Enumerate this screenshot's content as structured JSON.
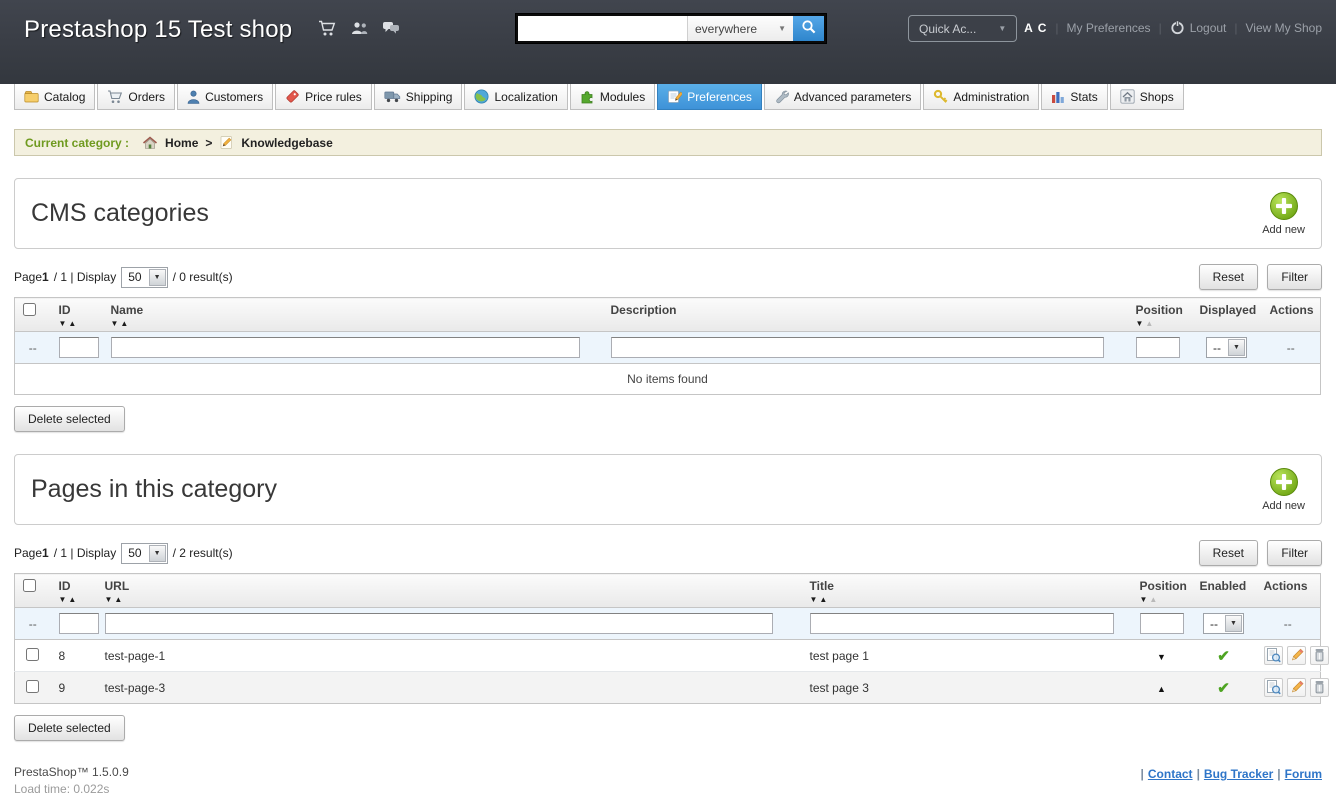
{
  "icons": {
    "sort_down": "▼",
    "sort_up": "▲",
    "dropdown_arrow": "▼",
    "check": "✔",
    "dash": "--",
    "pipe": "|",
    "breadcrumb_sep": ">"
  },
  "colors": {
    "header_bg": "#383C44",
    "active_tab_blue": "#4AA1DC",
    "breadcrumb_bg": "#F3F0DF",
    "breadcrumb_label_green": "#6F9A1F",
    "add_new_green": "#72AA16",
    "enabled_check_green": "#4EA422",
    "footer_link_blue": "#2E75C8",
    "filter_row_bg": "#EDF5FC"
  },
  "header": {
    "shop_title": "Prestashop 15 Test shop",
    "search_scope": "everywhere",
    "quick_access": "Quick Ac...",
    "user_initials": "A C",
    "my_preferences": "My Preferences",
    "logout": "Logout",
    "view_my_shop": "View My Shop"
  },
  "nav": {
    "tabs": [
      {
        "label": "Catalog",
        "icon": "folder-icon"
      },
      {
        "label": "Orders",
        "icon": "cart-icon"
      },
      {
        "label": "Customers",
        "icon": "customer-icon"
      },
      {
        "label": "Price rules",
        "icon": "price-tag-icon"
      },
      {
        "label": "Shipping",
        "icon": "truck-icon"
      },
      {
        "label": "Localization",
        "icon": "globe-icon"
      },
      {
        "label": "Modules",
        "icon": "puzzle-icon"
      },
      {
        "label": "Preferences",
        "icon": "notepad-pencil-icon",
        "active": true
      },
      {
        "label": "Advanced parameters",
        "icon": "wrench-icon"
      },
      {
        "label": "Administration",
        "icon": "key-icon"
      },
      {
        "label": "Stats",
        "icon": "bar-chart-icon"
      },
      {
        "label": "Shops",
        "icon": "shop-home-icon"
      }
    ]
  },
  "breadcrumb": {
    "label": "Current category :",
    "home": "Home",
    "current": "Knowledgebase"
  },
  "cms_categories": {
    "title": "CMS categories",
    "add_new": "Add new",
    "pagination": {
      "page_word": "Page",
      "page_num": "1",
      "page_total": "/ 1 | Display",
      "page_size": "50",
      "results": "/ 0 result(s)"
    },
    "reset": "Reset",
    "filter": "Filter",
    "columns": {
      "id": "ID",
      "name": "Name",
      "description": "Description",
      "position": "Position",
      "displayed": "Displayed",
      "actions": "Actions"
    },
    "empty": "No items found",
    "delete_selected": "Delete selected"
  },
  "pages_category": {
    "title": "Pages in this category",
    "add_new": "Add new",
    "pagination": {
      "page_word": "Page",
      "page_num": "1",
      "page_total": "/ 1 | Display",
      "page_size": "50",
      "results": "/ 2 result(s)"
    },
    "reset": "Reset",
    "filter": "Filter",
    "columns": {
      "id": "ID",
      "url": "URL",
      "title": "Title",
      "position": "Position",
      "enabled": "Enabled",
      "actions": "Actions"
    },
    "rows": [
      {
        "id": "8",
        "url": "test-page-1",
        "title": "test page 1",
        "position_glyph": "▼",
        "enabled_glyph": "✔"
      },
      {
        "id": "9",
        "url": "test-page-3",
        "title": "test page 3",
        "position_glyph": "▲",
        "enabled_glyph": "✔"
      }
    ],
    "delete_selected": "Delete selected"
  },
  "footer": {
    "version": "PrestaShop™ 1.5.0.9",
    "load_time": "Load time: 0.022s",
    "links": [
      {
        "label": "Contact"
      },
      {
        "label": "Bug Tracker"
      },
      {
        "label": "Forum"
      }
    ]
  }
}
